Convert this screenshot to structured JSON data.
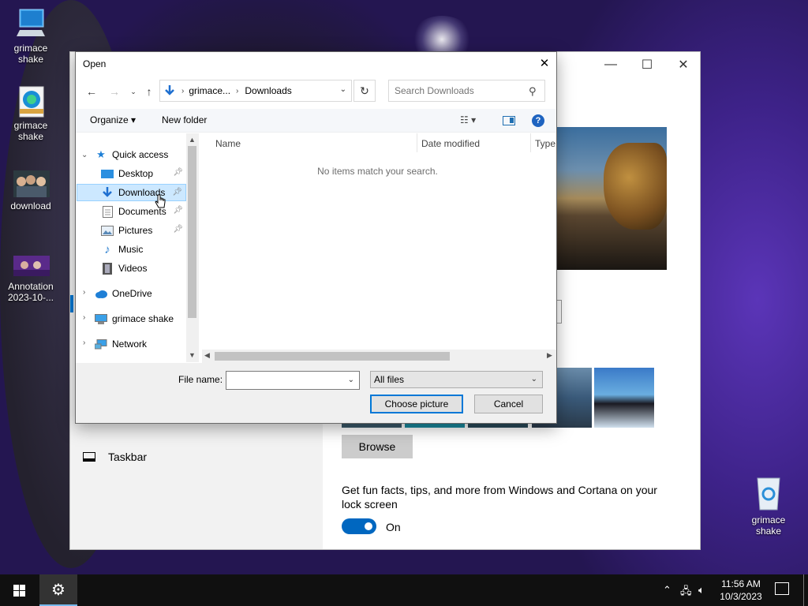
{
  "desktop": {
    "icons": [
      {
        "label": "grimace shake",
        "icon": "computer-icon"
      },
      {
        "label": "grimace shake",
        "icon": "edge-document-icon"
      },
      {
        "label": "download",
        "icon": "image-thumbnail-icon"
      },
      {
        "label": "Annotation 2023-10-...",
        "icon": "image-thumbnail-icon"
      },
      {
        "label": "grimace shake",
        "icon": "recycle-bin-icon"
      }
    ]
  },
  "settings_window": {
    "taskbar_label": "Taskbar",
    "browse_label": "Browse",
    "lock_screen_text": "Get fun facts, tips, and more from Windows and Cortana on your lock screen",
    "toggle_state": "On",
    "toggle_on": true,
    "controls": {
      "minimize": "—",
      "maximize": "☐",
      "close": "✕"
    }
  },
  "dialog": {
    "title": "Open",
    "close": "✕",
    "address": {
      "root_crumb": "grimace...",
      "current": "Downloads"
    },
    "search_placeholder": "Search Downloads",
    "toolbar": {
      "organize": "Organize ▾",
      "new_folder": "New folder",
      "help": "?"
    },
    "tree": {
      "quick_access": "Quick access",
      "desktop": "Desktop",
      "downloads": "Downloads",
      "documents": "Documents",
      "pictures": "Pictures",
      "music": "Music",
      "videos": "Videos",
      "onedrive": "OneDrive",
      "this_pc": "grimace shake",
      "network": "Network"
    },
    "columns": {
      "name": "Name",
      "date": "Date modified",
      "type": "Type"
    },
    "empty_message": "No items match your search.",
    "file_name_label": "File name:",
    "file_name_value": "",
    "filter_value": "All files",
    "choose_button": "Choose picture",
    "cancel_button": "Cancel"
  },
  "taskbar": {
    "time": "11:56 AM",
    "date": "10/3/2023"
  },
  "colors": {
    "accent": "#0078d7",
    "selection": "#cce8ff",
    "taskbar": "#101010"
  }
}
